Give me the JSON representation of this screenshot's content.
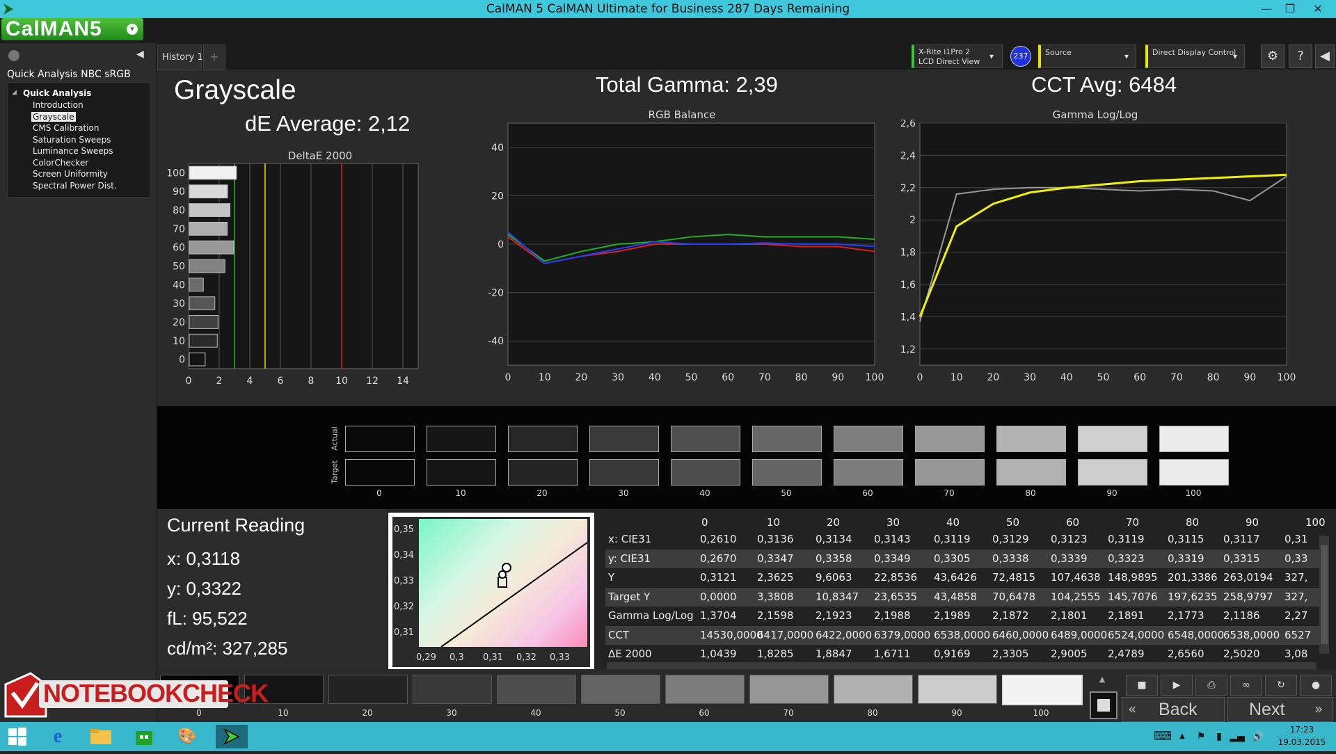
{
  "window": {
    "title": "CalMAN 5 CalMAN Ultimate for Business 287 Days Remaining"
  },
  "app": {
    "logo_text": "CalMAN5",
    "workflow_title": "Quick Analysis NBC sRGB",
    "history_tab": "History 1",
    "add_tab": "+"
  },
  "sidebar": {
    "section": "Quick Analysis",
    "items": [
      {
        "label": "Introduction",
        "selected": false
      },
      {
        "label": "Grayscale",
        "selected": true
      },
      {
        "label": "CMS Calibration",
        "selected": false
      },
      {
        "label": "Saturation Sweeps",
        "selected": false
      },
      {
        "label": "Luminance Sweeps",
        "selected": false
      },
      {
        "label": "ColorChecker",
        "selected": false
      },
      {
        "label": "Screen Uniformity",
        "selected": false
      },
      {
        "label": "Spectral Power Dist.",
        "selected": false
      }
    ]
  },
  "controls": {
    "meter_line1": "X-Rite i1Pro 2",
    "meter_line2": "LCD Direct View",
    "meter_badge": "237",
    "source": "Source",
    "display": "Direct Display Control"
  },
  "page": {
    "title": "Grayscale",
    "de_average": "dE Average: 2,12",
    "total_gamma": "Total Gamma: 2,39",
    "cct_avg": "CCT Avg: 6484"
  },
  "charts": {
    "deltae_title": "DeltaE 2000",
    "rgb_title": "RGB Balance",
    "gamma_title": "Gamma Log/Log"
  },
  "chart_data": [
    {
      "type": "bar",
      "title": "DeltaE 2000",
      "orientation": "horizontal",
      "categories": [
        "0",
        "10",
        "20",
        "30",
        "40",
        "50",
        "60",
        "70",
        "80",
        "90",
        "100"
      ],
      "values": [
        1.04,
        1.83,
        1.88,
        1.67,
        0.92,
        2.33,
        2.9,
        2.48,
        2.66,
        2.5,
        3.08
      ],
      "xlim": [
        0,
        15
      ],
      "x_ticks": [
        "0",
        "2",
        "4",
        "6",
        "8",
        "10",
        "12",
        "14"
      ],
      "reference_lines": [
        {
          "value": 3,
          "color": "#2fb52f"
        },
        {
          "value": 5,
          "color": "#e8e800"
        },
        {
          "value": 10,
          "color": "#e02020"
        }
      ]
    },
    {
      "type": "line",
      "title": "RGB Balance",
      "x": [
        0,
        10,
        20,
        30,
        40,
        50,
        60,
        70,
        80,
        90,
        100
      ],
      "x_ticks": [
        "0",
        "10",
        "20",
        "30",
        "40",
        "50",
        "60",
        "70",
        "80",
        "90",
        "100"
      ],
      "y_ticks": [
        "40",
        "20",
        "0",
        "-20",
        "-40"
      ],
      "ylim": [
        -50,
        50
      ],
      "series": [
        {
          "color": "#e02020",
          "values": [
            3,
            -8,
            -5,
            -3,
            0,
            0,
            0,
            0,
            -1,
            -1,
            -3
          ]
        },
        {
          "color": "#20b020",
          "values": [
            4,
            -7,
            -3,
            0,
            1,
            3,
            4,
            3,
            3,
            3,
            2
          ]
        },
        {
          "color": "#2040ff",
          "values": [
            5,
            -8,
            -5,
            -2,
            1,
            0,
            0,
            0.5,
            0,
            0,
            -1
          ]
        }
      ]
    },
    {
      "type": "line",
      "title": "Gamma Log/Log",
      "x": [
        0,
        10,
        20,
        30,
        40,
        50,
        60,
        70,
        80,
        90,
        100
      ],
      "x_ticks": [
        "0",
        "10",
        "20",
        "30",
        "40",
        "50",
        "60",
        "70",
        "80",
        "90",
        "100"
      ],
      "y_ticks": [
        "2,6",
        "2,4",
        "2,2",
        "2",
        "1,8",
        "1,6",
        "1,4",
        "1,2"
      ],
      "ylim": [
        1.1,
        2.6
      ],
      "series": [
        {
          "color": "#999999",
          "values": [
            1.37,
            2.16,
            2.19,
            2.2,
            2.2,
            2.19,
            2.18,
            2.19,
            2.18,
            2.12,
            2.27
          ]
        },
        {
          "color": "#f2f200",
          "values": [
            1.4,
            1.96,
            2.1,
            2.17,
            2.2,
            2.22,
            2.24,
            2.25,
            2.26,
            2.27,
            2.28
          ]
        }
      ]
    }
  ],
  "swatches": {
    "actual_label": "Actual",
    "target_label": "Target",
    "labels": [
      "0",
      "10",
      "20",
      "30",
      "40",
      "50",
      "60",
      "70",
      "80",
      "90",
      "100"
    ],
    "actual_colors": [
      "#0a0a0a",
      "#161616",
      "#262626",
      "#3a3a3a",
      "#4f4f4f",
      "#666666",
      "#7e7e7e",
      "#989898",
      "#b3b3b3",
      "#cfcfcf",
      "#ececec"
    ],
    "target_colors": [
      "#080808",
      "#151515",
      "#252525",
      "#393939",
      "#4e4e4e",
      "#656565",
      "#7d7d7d",
      "#979797",
      "#b2b2b2",
      "#cecece",
      "#ebebeb"
    ]
  },
  "reading": {
    "title": "Current Reading",
    "x": "x: 0,3118",
    "y": "y: 0,3322",
    "fl": "fL: 95,522",
    "cd": "cd/m²: 327,285"
  },
  "cie": {
    "y_ticks": [
      "0,35",
      "0,34",
      "0,33",
      "0,32",
      "0,31"
    ],
    "x_ticks": [
      "0,29",
      "0,3",
      "0,31",
      "0,32",
      "0,33"
    ]
  },
  "table": {
    "headers": [
      "0",
      "10",
      "20",
      "30",
      "40",
      "50",
      "60",
      "70",
      "80",
      "90",
      "100"
    ],
    "rows": [
      {
        "label": "x: CIE31",
        "values": [
          "0,2610",
          "0,3136",
          "0,3134",
          "0,3143",
          "0,3119",
          "0,3129",
          "0,3123",
          "0,3119",
          "0,3115",
          "0,3117",
          "0,31"
        ]
      },
      {
        "label": "y: CIE31",
        "values": [
          "0,2670",
          "0,3347",
          "0,3358",
          "0,3349",
          "0,3305",
          "0,3338",
          "0,3339",
          "0,3323",
          "0,3319",
          "0,3315",
          "0,33"
        ]
      },
      {
        "label": "Y",
        "values": [
          "0,3121",
          "2,3625",
          "9,6063",
          "22,8536",
          "43,6426",
          "72,4815",
          "107,4638",
          "148,9895",
          "201,3386",
          "263,0194",
          "327,"
        ]
      },
      {
        "label": "Target Y",
        "values": [
          "0,0000",
          "3,3808",
          "10,8347",
          "23,6535",
          "43,4858",
          "70,6478",
          "104,2555",
          "145,7076",
          "197,6235",
          "258,9797",
          "327,"
        ]
      },
      {
        "label": "Gamma Log/Log",
        "values": [
          "1,3704",
          "2,1598",
          "2,1923",
          "2,1988",
          "2,1989",
          "2,1872",
          "2,1801",
          "2,1891",
          "2,1773",
          "2,1186",
          "2,27"
        ]
      },
      {
        "label": "CCT",
        "values": [
          "14530,0000",
          "6417,0000",
          "6422,0000",
          "6379,0000",
          "6538,0000",
          "6460,0000",
          "6489,0000",
          "6524,0000",
          "6548,0000",
          "6538,0000",
          "6527"
        ]
      },
      {
        "label": "ΔE 2000",
        "values": [
          "1,0439",
          "1,8285",
          "1,8847",
          "1,6711",
          "0,9169",
          "2,3305",
          "2,9005",
          "2,4789",
          "2,6560",
          "2,5020",
          "3,08"
        ]
      }
    ]
  },
  "bottom": {
    "labels": [
      "0",
      "10",
      "20",
      "30",
      "40",
      "50",
      "60",
      "70",
      "80",
      "90",
      "100"
    ],
    "colors": [
      "#060606",
      "#141414",
      "#242424",
      "#383838",
      "#4d4d4d",
      "#646464",
      "#7c7c7c",
      "#969696",
      "#b1b1b1",
      "#cdcdcd",
      "#f4f4f4"
    ],
    "back": "Back",
    "next": "Next"
  },
  "watermark": "NOTEBOOKCHECK",
  "taskbar": {
    "time": "17:23",
    "date": "19.03.2015"
  }
}
